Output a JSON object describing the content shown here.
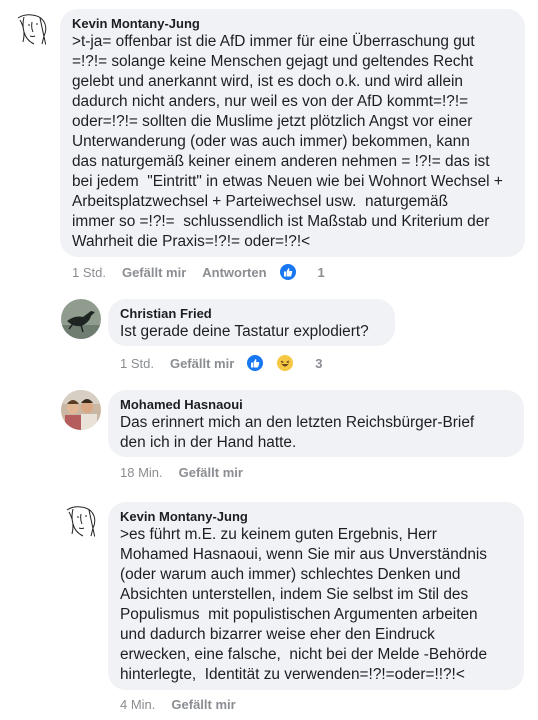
{
  "comments": [
    {
      "author": "Kevin Montany-Jung",
      "text": ">t-ja= offenbar ist die AfD immer für eine Überraschung gut\n=!?!= solange keine Menschen gejagt und geltendes Recht\ngelebt und anerkannt wird, ist es doch o.k. und wird allein\ndadurch nicht anders, nur weil es von der AfD kommt=!?!=\noder=!?!= sollten die Muslime jetzt plötzlich Angst vor einer\nUnterwanderung (oder was auch immer) bekommen, kann\ndas naturgemäß keiner einem anderen nehmen = !?!= das ist\nbei jedem  \"Eintritt\" in etwas Neuen wie bei Wohnort Wechsel +\nArbeitsplatzwechsel + Parteiwechsel usw.  naturgemäß\nimmer so =!?!=  schlussendlich ist Maßstab und Kriterium der\nWahrheit die Praxis=!?!= oder=!?!<",
      "time": "1 Std.",
      "like_label": "Gefällt mir",
      "reply_label": "Antworten",
      "reaction_count": "1"
    },
    {
      "author": "Christian Fried",
      "text": "Ist gerade deine Tastatur explodiert?",
      "time": "1 Std.",
      "like_label": "Gefällt mir",
      "reaction_count": "3"
    },
    {
      "author": "Mohamed Hasnaoui",
      "text": "Das erinnert mich an den letzten Reichsbürger-Brief\nden ich in der Hand hatte.",
      "time": "18 Min.",
      "like_label": "Gefällt mir"
    },
    {
      "author": "Kevin Montany-Jung",
      "text": ">es führt m.E. zu keinem guten Ergebnis, Herr\nMohamed Hasnaoui, wenn Sie mir aus Unverständnis\n(oder warum auch immer) schlechtes Denken und\nAbsichten unterstellen, indem Sie selbst im Stil des\nPopulismus  mit populistischen Argumenten arbeiten\nund dadurch bizarrer weise eher den Eindruck\nerwecken, eine falsche,  nicht bei der Melde -Behörde\nhinterlegte,  Identität zu verwenden=!?!=oder=!!?!<",
      "time": "4 Min.",
      "like_label": "Gefällt mir"
    }
  ],
  "colors": {
    "bubble": "#f0f2f5",
    "meta": "#8a8d91",
    "like_blue": "#1877f2"
  }
}
